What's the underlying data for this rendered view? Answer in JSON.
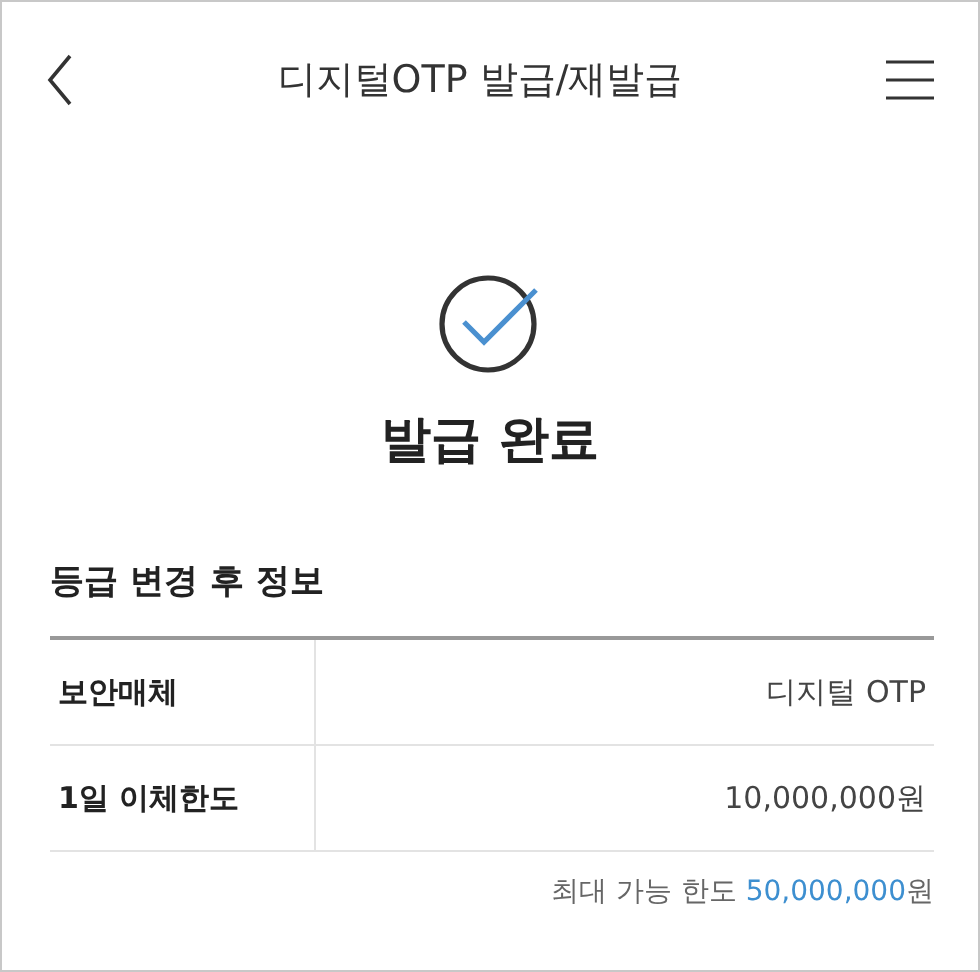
{
  "header": {
    "title": "디지털OTP 발급/재발급"
  },
  "result": {
    "kind": "success",
    "title": "발급 완료"
  },
  "section": {
    "title": "등급 변경 후 정보",
    "rows": [
      {
        "label": "보안매체",
        "value": "디지털 OTP"
      },
      {
        "label": "1일 이체한도",
        "value": "10,000,000원"
      }
    ]
  },
  "note": {
    "label": "최대 가능 한도",
    "amount": "50,000,000",
    "unit": "원"
  }
}
